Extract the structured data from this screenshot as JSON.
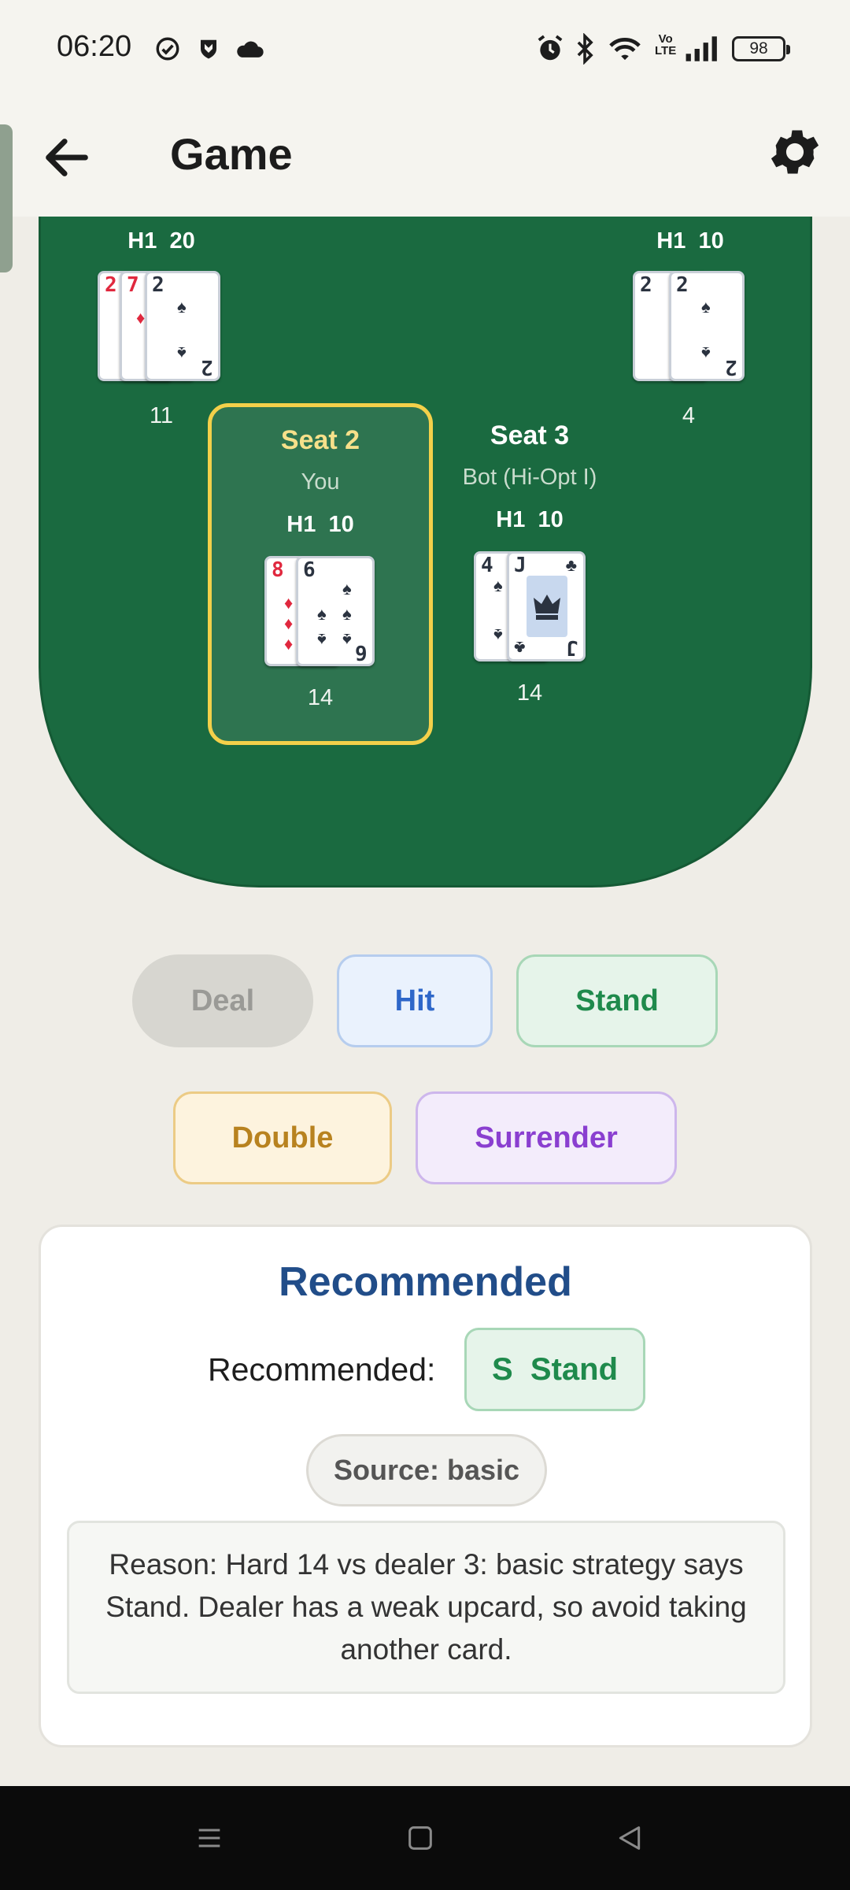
{
  "status_bar": {
    "time": "06:20",
    "battery": "98",
    "icons": [
      "check-circle-icon",
      "shield-icon",
      "cloud-icon",
      "alarm-icon",
      "bluetooth-icon",
      "wifi-icon",
      "volte-icon",
      "signal-icon",
      "battery-icon"
    ]
  },
  "header": {
    "title": "Game",
    "back_icon": "arrow-left-icon",
    "settings_icon": "gear-icon"
  },
  "table": {
    "felt_color": "#1a6a40",
    "seats": [
      {
        "id": "seat-1",
        "hand_label": "H1  20",
        "total": "11",
        "cards": [
          {
            "rank": "2",
            "suit": "♦"
          },
          {
            "rank": "7",
            "suit": "♦"
          },
          {
            "rank": "2",
            "suit": "♠"
          }
        ]
      },
      {
        "id": "seat-2",
        "name": "Seat 2",
        "subtitle": "You",
        "hand_label": "H1  10",
        "total": "14",
        "active": true,
        "cards": [
          {
            "rank": "8",
            "suit": "♦"
          },
          {
            "rank": "6",
            "suit": "♠"
          }
        ]
      },
      {
        "id": "seat-3",
        "name": "Seat 3",
        "subtitle": "Bot (Hi-Opt I)",
        "hand_label": "H1  10",
        "total": "14",
        "cards": [
          {
            "rank": "4",
            "suit": "♠"
          },
          {
            "rank": "J",
            "suit": "♣"
          }
        ]
      },
      {
        "id": "seat-4",
        "hand_label": "H1  10",
        "total": "4",
        "cards": [
          {
            "rank": "2",
            "suit": "♠"
          },
          {
            "rank": "2",
            "suit": "♠"
          }
        ]
      }
    ]
  },
  "actions": {
    "deal": "Deal",
    "hit": "Hit",
    "stand": "Stand",
    "double": "Double",
    "surrender": "Surrender"
  },
  "recommendation": {
    "title": "Recommended",
    "label": "Recommended:",
    "action": "S  Stand",
    "source": "Source: basic",
    "reason": "Reason: Hard 14 vs dealer 3: basic strategy says Stand. Dealer has a weak upcard, so avoid taking another card."
  },
  "nav_bar": {
    "icons": [
      "menu-icon",
      "home-square-icon",
      "back-triangle-icon"
    ]
  }
}
